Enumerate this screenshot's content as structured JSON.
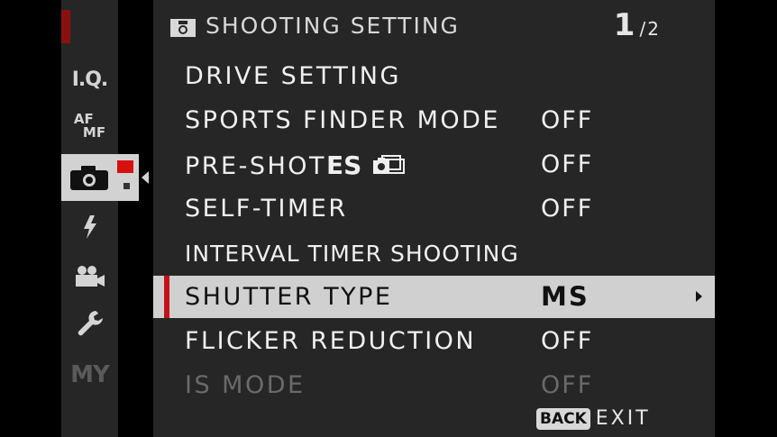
{
  "sidebar": {
    "items": [
      {
        "id": "iq",
        "label": "I.Q."
      },
      {
        "id": "afmf",
        "label_top": "AF",
        "label_bottom": "MF"
      },
      {
        "id": "shooting",
        "icon": "camera-icon",
        "active": true
      },
      {
        "id": "flash",
        "icon": "flash-icon"
      },
      {
        "id": "movie",
        "icon": "movie-camera-icon"
      },
      {
        "id": "setup",
        "icon": "wrench-icon"
      },
      {
        "id": "my",
        "label": "MY"
      }
    ]
  },
  "header": {
    "icon": "camera-icon",
    "title": "SHOOTING SETTING",
    "page_current": "1",
    "page_total": "/2"
  },
  "menu": {
    "rows": [
      {
        "label": "DRIVE SETTING",
        "value": ""
      },
      {
        "label": "SPORTS FINDER MODE",
        "value": "OFF"
      },
      {
        "label": "PRE-SHOT",
        "label_badge": "ES",
        "value": "OFF"
      },
      {
        "label": "SELF-TIMER",
        "value": "OFF"
      },
      {
        "label": "INTERVAL TIMER SHOOTING",
        "value": ""
      },
      {
        "label": "SHUTTER TYPE",
        "value": "MS",
        "selected": true
      },
      {
        "label": "FLICKER REDUCTION",
        "value": "OFF"
      },
      {
        "label": "IS MODE",
        "value": "OFF",
        "disabled": true
      }
    ]
  },
  "footer": {
    "back_label": "BACK",
    "exit_label": "EXIT"
  },
  "colors": {
    "accent_red": "#c4121a",
    "panel_bg": "#262626",
    "selected_bg": "#d0d0d0"
  }
}
